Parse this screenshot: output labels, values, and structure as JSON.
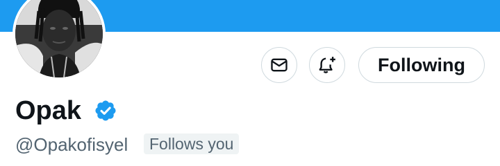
{
  "banner": {
    "color": "#1d9bf0"
  },
  "avatar": {
    "alt": "Profile photo",
    "icon": "profile-photo"
  },
  "actions": {
    "message_icon": "envelope-icon",
    "notify_icon": "bell-plus-icon",
    "follow_label": "Following"
  },
  "profile": {
    "display_name": "Opak",
    "verified": true,
    "verified_color": "#1d9bf0",
    "handle": "@Opakofisyel",
    "follows_you_label": "Follows you"
  }
}
